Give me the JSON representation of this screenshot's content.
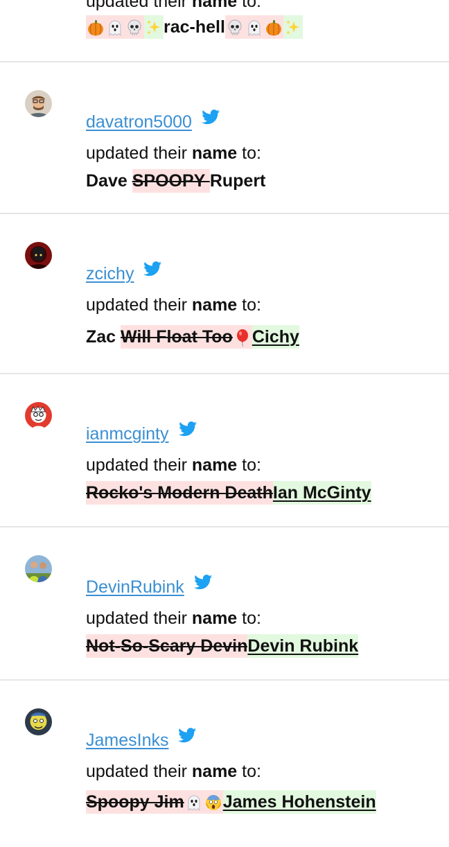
{
  "fragment": {
    "cut_prefix": "updated their ",
    "cut_bold": "name",
    "cut_suffix": " to:",
    "del_emojis": [
      "pumpkin-icon",
      "ghost-icon",
      "skull-icon"
    ],
    "ins_emojis_a": [
      "sparkles-icon"
    ],
    "keep_text": "rac-hell",
    "del_emojis_b": [
      "skull-icon",
      "ghost-icon",
      "pumpkin-icon"
    ],
    "ins_emojis_b": [
      "sparkles-icon"
    ]
  },
  "labels": {
    "updated_prefix": "updated their ",
    "updated_bold": "name",
    "updated_suffix": " to:"
  },
  "entries": [
    {
      "username": "davatron5000",
      "keep_before": "Dave ",
      "deleted": "SPOOPY ",
      "inserted": "",
      "keep_after": "Rupert"
    },
    {
      "username": "zcichy",
      "keep_before": "Zac ",
      "deleted": "Will Float Too",
      "inserted": "Cichy",
      "keep_after": ""
    },
    {
      "username": "ianmcginty",
      "keep_before": "",
      "deleted": "Rocko's Modern Death",
      "inserted": "Ian McGinty",
      "keep_after": ""
    },
    {
      "username": "DevinRubink",
      "keep_before": "",
      "deleted": "Not-So-Scary Devin",
      "inserted": "Devin Rubink",
      "keep_after": ""
    },
    {
      "username": "JamesInks",
      "keep_before": "",
      "deleted": "Spoopy Jim",
      "inserted": "James Hohenstein",
      "keep_after": ""
    }
  ],
  "colors": {
    "link": "#3a8fd3",
    "twitter": "#1da1f2",
    "deleted_bg": "#fde1e1",
    "inserted_bg": "#e2f9df",
    "divider": "#e6e6e6"
  }
}
